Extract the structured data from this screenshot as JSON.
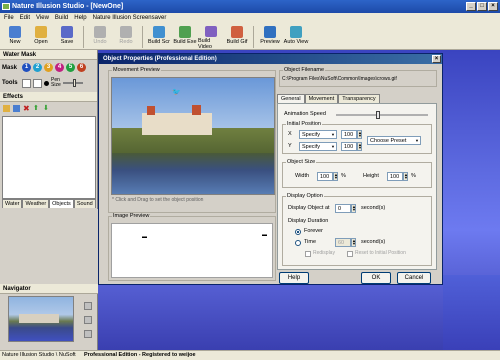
{
  "app_title": "Nature Illusion Studio - [NewOne]",
  "menu": [
    "File",
    "Edit",
    "View",
    "Build",
    "Help",
    "Nature Illusion Screensaver"
  ],
  "toolbar": [
    {
      "label": "New",
      "icon": "new-doc-icon",
      "color": "#4a7ed0",
      "enabled": true
    },
    {
      "label": "Open",
      "icon": "open-folder-icon",
      "color": "#e0b040",
      "enabled": true
    },
    {
      "label": "Save",
      "icon": "save-disk-icon",
      "color": "#5a6ac8",
      "enabled": true
    },
    {
      "label": "Undo",
      "icon": "undo-icon",
      "color": "#b0b0b0",
      "enabled": false
    },
    {
      "label": "Redo",
      "icon": "redo-icon",
      "color": "#b0b0b0",
      "enabled": false
    },
    {
      "label": "Build Scr",
      "icon": "build-scr-icon",
      "color": "#4090d0",
      "enabled": true
    },
    {
      "label": "Build Exe",
      "icon": "build-exe-icon",
      "color": "#50a050",
      "enabled": true
    },
    {
      "label": "Build Video",
      "icon": "build-video-icon",
      "color": "#8060c0",
      "enabled": true
    },
    {
      "label": "Build Gif",
      "icon": "build-gif-icon",
      "color": "#d06040",
      "enabled": true
    },
    {
      "label": "Preview",
      "icon": "preview-icon",
      "color": "#3070c0",
      "enabled": true
    },
    {
      "label": "Auto View",
      "icon": "auto-view-icon",
      "color": "#40a0c0",
      "enabled": true
    }
  ],
  "left": {
    "water_mask_title": "Water Mask",
    "mask_label": "Mask",
    "mask_layers": [
      "1",
      "2",
      "3",
      "4",
      "5",
      "6"
    ],
    "mask_colors": [
      "#2050c0",
      "#20a0d0",
      "#e0a020",
      "#c02080",
      "#20a040",
      "#c04020"
    ],
    "tools_label": "Tools",
    "pen_label": "Pen",
    "size_label": "Size",
    "effects_title": "Effects",
    "tabs": [
      "Water",
      "Weather",
      "Objects",
      "Sound"
    ],
    "active_tab": "Objects",
    "navigator_title": "Navigator"
  },
  "dialog": {
    "title": "Object Properties (Professional Edition)",
    "movement_preview_label": "Movement Preview",
    "hint": "* Click and Drag to set the object position",
    "image_preview_label": "Image Preview",
    "filename_label": "Object Filename",
    "filename": "C:\\Program Files\\NuSoft\\Common\\Images\\crows.gif",
    "tabs": [
      "General",
      "Movement",
      "Transparency"
    ],
    "active_tab": "General",
    "animation_speed_label": "Animation Speed",
    "animation_speed_percent": 45,
    "initial_position_label": "Initial Position",
    "x_label": "X",
    "y_label": "Y",
    "specify": "Specify",
    "x_value": "100",
    "y_value": "100",
    "choose_preset": "Choose Preset",
    "object_size_label": "Object Size",
    "width_label": "Width",
    "width_value": "100",
    "height_label": "Height",
    "height_value": "100",
    "percent": "%",
    "display_option_label": "Display Option",
    "display_at_label": "Display Object at",
    "display_at_value": "0",
    "seconds": "second(s)",
    "duration_label": "Display Duration",
    "forever_label": "Forever",
    "time_label": "Time",
    "time_value": "60",
    "redisplay_label": "Redisplay",
    "reset_label": "Reset to Initial Position",
    "help_button": "Help",
    "ok_button": "OK",
    "cancel_button": "Cancel"
  },
  "status": {
    "left": "Nature Illusion Studio \\ NuSoft",
    "edition": "Professional Edition - Registered to weijoe"
  }
}
